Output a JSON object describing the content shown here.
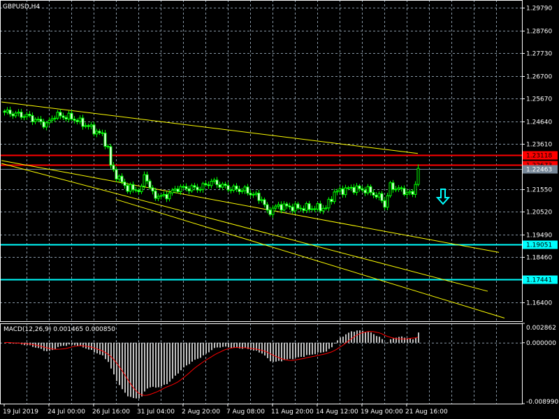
{
  "window": {
    "symbol_title": "GBPUSD,H4"
  },
  "colors": {
    "background": "#000000",
    "grid": "#8a9aa8",
    "candle_outline": "#00ff00",
    "bull_body": "#000000",
    "bear_body": "#ffffff",
    "trendline": "#ffff00",
    "resistance": "#ff0000",
    "support": "#00ffff",
    "bid_line": "#778899",
    "macd_hist": "#c0c0c0",
    "macd_signal": "#ff0000"
  },
  "chart_data": [
    {
      "type": "candlestick",
      "title": "GBPUSD,H4",
      "ylim": [
        1.1555,
        1.3012
      ],
      "y_ticks": [
        "1.29790",
        "1.28760",
        "1.27730",
        "1.26700",
        "1.25670",
        "1.24640",
        "1.23610",
        "1.21550",
        "1.20520",
        "1.19490",
        "1.18460",
        "1.16400"
      ],
      "x_ticks": [
        "19 Jul 2019",
        "24 Jul 00:00",
        "26 Jul 16:00",
        "31 Jul 04:00",
        "2 Aug 20:00",
        "7 Aug 08:00",
        "11 Aug 20:00",
        "14 Aug 12:00",
        "19 Aug 00:00",
        "21 Aug 16:00"
      ],
      "x_tick_bars": [
        0,
        16,
        32,
        48,
        64,
        80,
        96,
        112,
        128,
        144
      ],
      "bar_count": 149,
      "close_keypoints": [
        [
          0,
          1.2505
        ],
        [
          8,
          1.2488
        ],
        [
          15,
          1.2448
        ],
        [
          18,
          1.2492
        ],
        [
          24,
          1.248
        ],
        [
          30,
          1.244
        ],
        [
          35,
          1.24
        ],
        [
          37,
          1.234
        ],
        [
          38,
          1.226
        ],
        [
          41,
          1.22
        ],
        [
          44,
          1.216
        ],
        [
          49,
          1.215
        ],
        [
          50,
          1.223
        ],
        [
          53,
          1.213
        ],
        [
          57,
          1.212
        ],
        [
          62,
          1.216
        ],
        [
          70,
          1.216
        ],
        [
          74,
          1.219
        ],
        [
          80,
          1.216
        ],
        [
          86,
          1.215
        ],
        [
          92,
          1.211
        ],
        [
          94,
          1.205
        ],
        [
          98,
          1.208
        ],
        [
          105,
          1.207
        ],
        [
          115,
          1.207
        ],
        [
          118,
          1.214
        ],
        [
          124,
          1.216
        ],
        [
          130,
          1.215
        ],
        [
          135,
          1.211
        ],
        [
          136,
          1.208
        ],
        [
          138,
          1.217
        ],
        [
          146,
          1.213
        ],
        [
          148,
          1.225
        ]
      ],
      "horizontal_levels": [
        {
          "price": 1.23118,
          "label": "1.23118",
          "kind": "resistance"
        },
        {
          "price": 1.22673,
          "label": "1.22673",
          "kind": "resistance"
        },
        {
          "price": 1.22463,
          "label": "1.22463",
          "kind": "bid"
        },
        {
          "price": 1.19051,
          "label": "1.19051",
          "kind": "support"
        },
        {
          "price": 1.17441,
          "label": "1.17441",
          "kind": "support"
        }
      ],
      "trendlines": [
        {
          "from": [
            -1,
            1.25519
          ],
          "to": [
            148,
            1.23175
          ]
        },
        {
          "from": [
            -1,
            1.22854
          ],
          "to": [
            177,
            1.18679
          ]
        },
        {
          "from": [
            -1,
            1.22725
          ],
          "to": [
            173,
            1.16913
          ]
        },
        {
          "from": [
            40,
            1.21087
          ],
          "to": [
            179,
            1.15693
          ]
        }
      ],
      "signal_arrow": {
        "direction": "down",
        "bar": 157,
        "price": 1.2155
      }
    },
    {
      "type": "bar+line",
      "title": "MACD(12,26,9) 0.001465 0.000850",
      "parameters": [
        12,
        26,
        9
      ],
      "current_main": 0.001465,
      "current_signal": 0.00085,
      "ylim": [
        -0.00899,
        0.002862
      ],
      "y_ticks": [
        "0.002862",
        "0.000000",
        "-0.008990"
      ]
    }
  ]
}
